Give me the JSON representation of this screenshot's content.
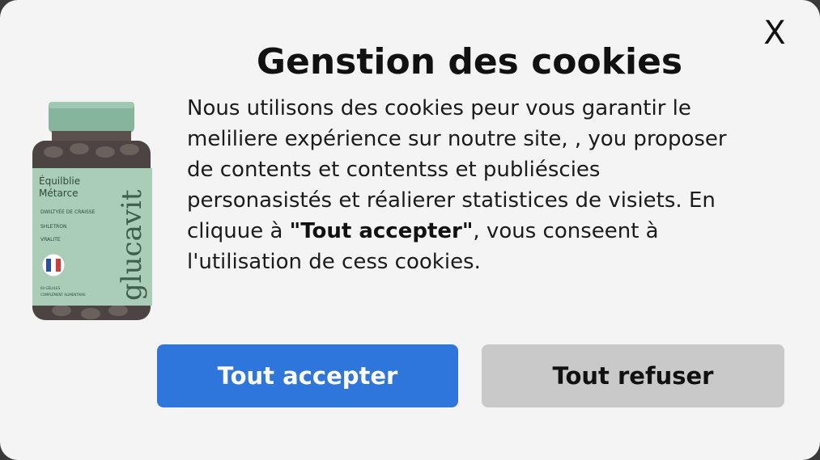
{
  "dialog": {
    "close_label": "X",
    "title": "Genstion des cookies",
    "message": {
      "lines": [
        "Nous utilisons des cookies peur vous garantir le",
        "meliliere expérience sur noutre site, , you  proposer",
        "de   contents   et   contentss   et   publiéscies",
        "personasistés et réalierer  statistices  de visiets. En",
        "cliquue  à "
      ],
      "bold_part": "\"Tout accepter\"",
      "after_bold": ", vous conseent à",
      "last_line": "l'utilisation de cess cookies."
    },
    "accept_label": "Tout accepter",
    "refuse_label": "Tout refuser"
  },
  "product_image": {
    "brand": "glucavit",
    "label_heading_1": "Équilblie",
    "label_heading_2": "Métarce",
    "bullets": [
      "DWILTYÉE DE CRAISSE",
      "SHLETRON",
      "VRALITE"
    ],
    "small_text_1": "60 GÉLULES",
    "small_text_2": "COMPLÉMENT ALIMENTAIRE"
  },
  "colors": {
    "accept_bg": "#2f76dc",
    "refuse_bg": "#c9c9c9",
    "dialog_bg": "#f4f4f4",
    "label_green": "#a9cdb6"
  }
}
